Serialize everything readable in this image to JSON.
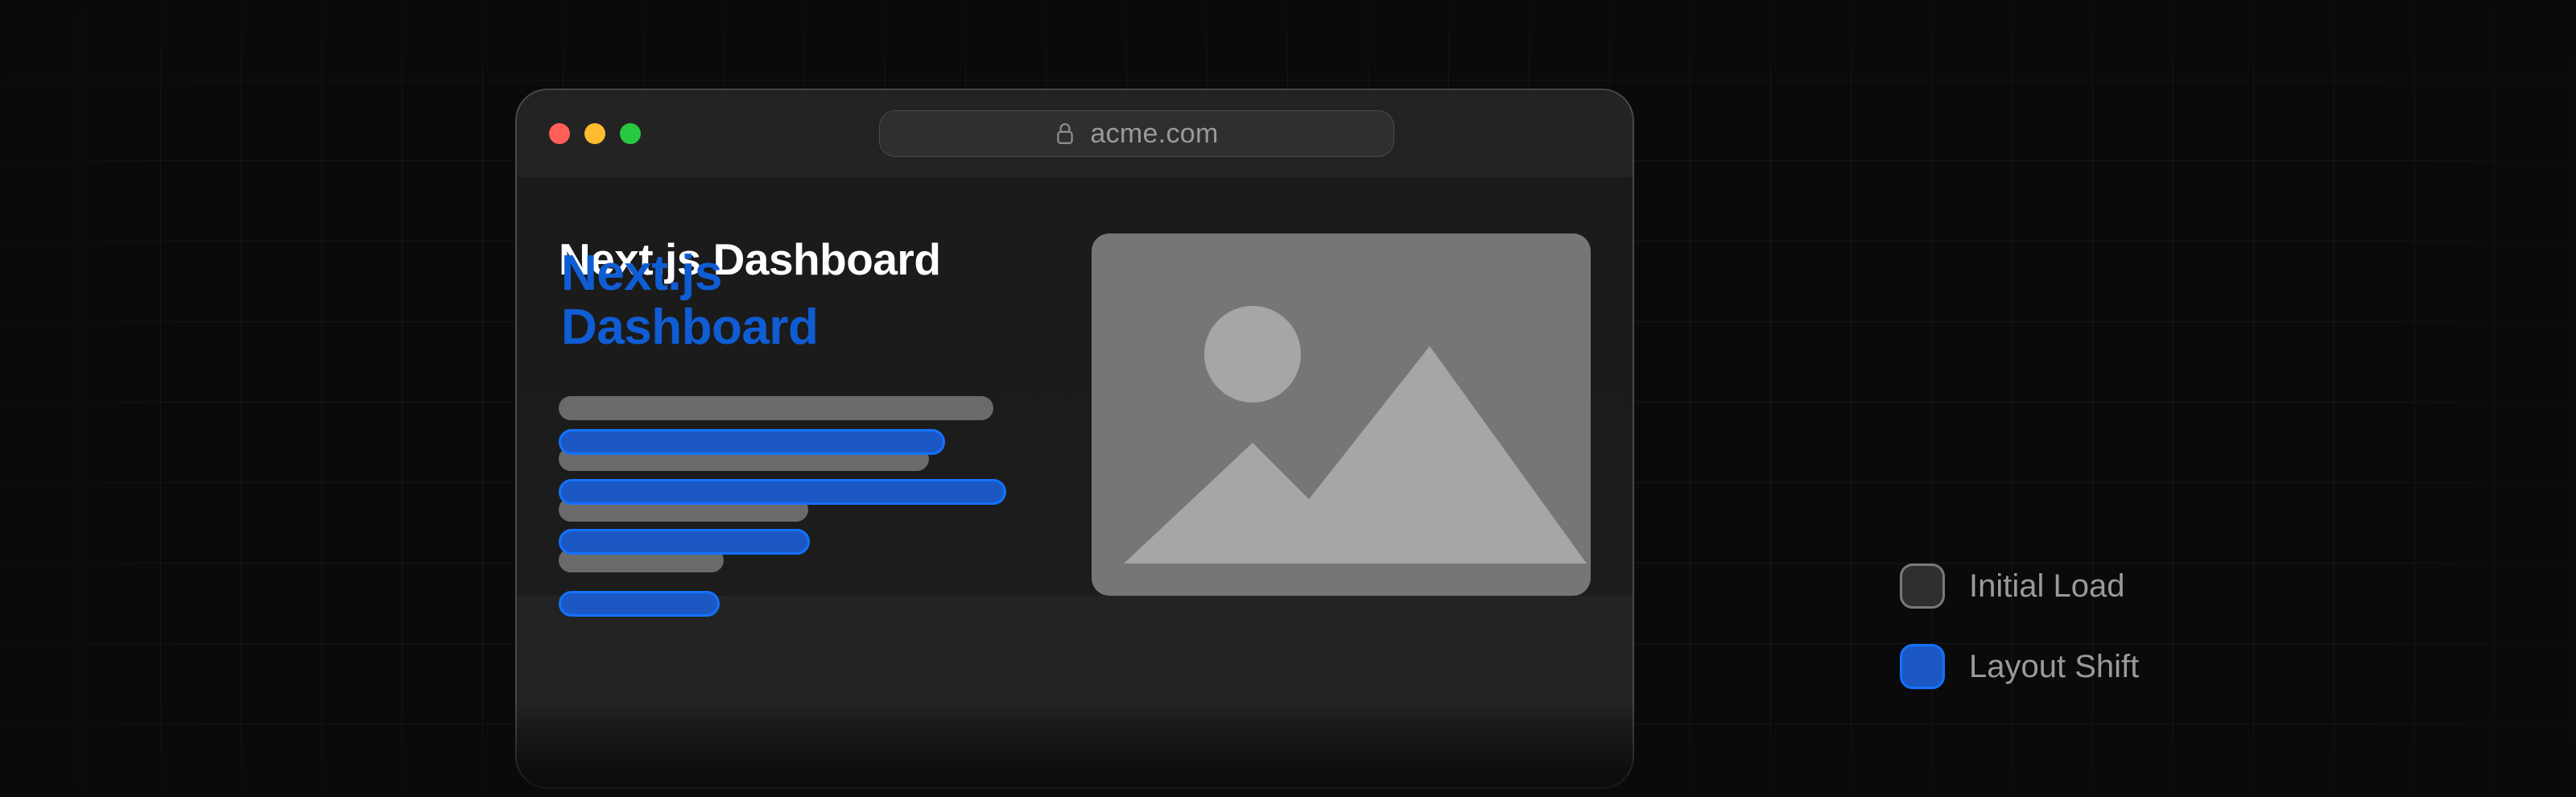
{
  "browser": {
    "url": "acme.com"
  },
  "page": {
    "title_initial": "Next.js Dashboard",
    "title_shift": "Next.js\nDashboard"
  },
  "legend": {
    "initial": "Initial Load",
    "shift": "Layout Shift"
  },
  "colors": {
    "initial_fill": "#6a6a6a",
    "shift_fill": "#1b58c4",
    "shift_border": "#1372ff",
    "window_bg": "#232323",
    "background": "#0a0a0a"
  }
}
